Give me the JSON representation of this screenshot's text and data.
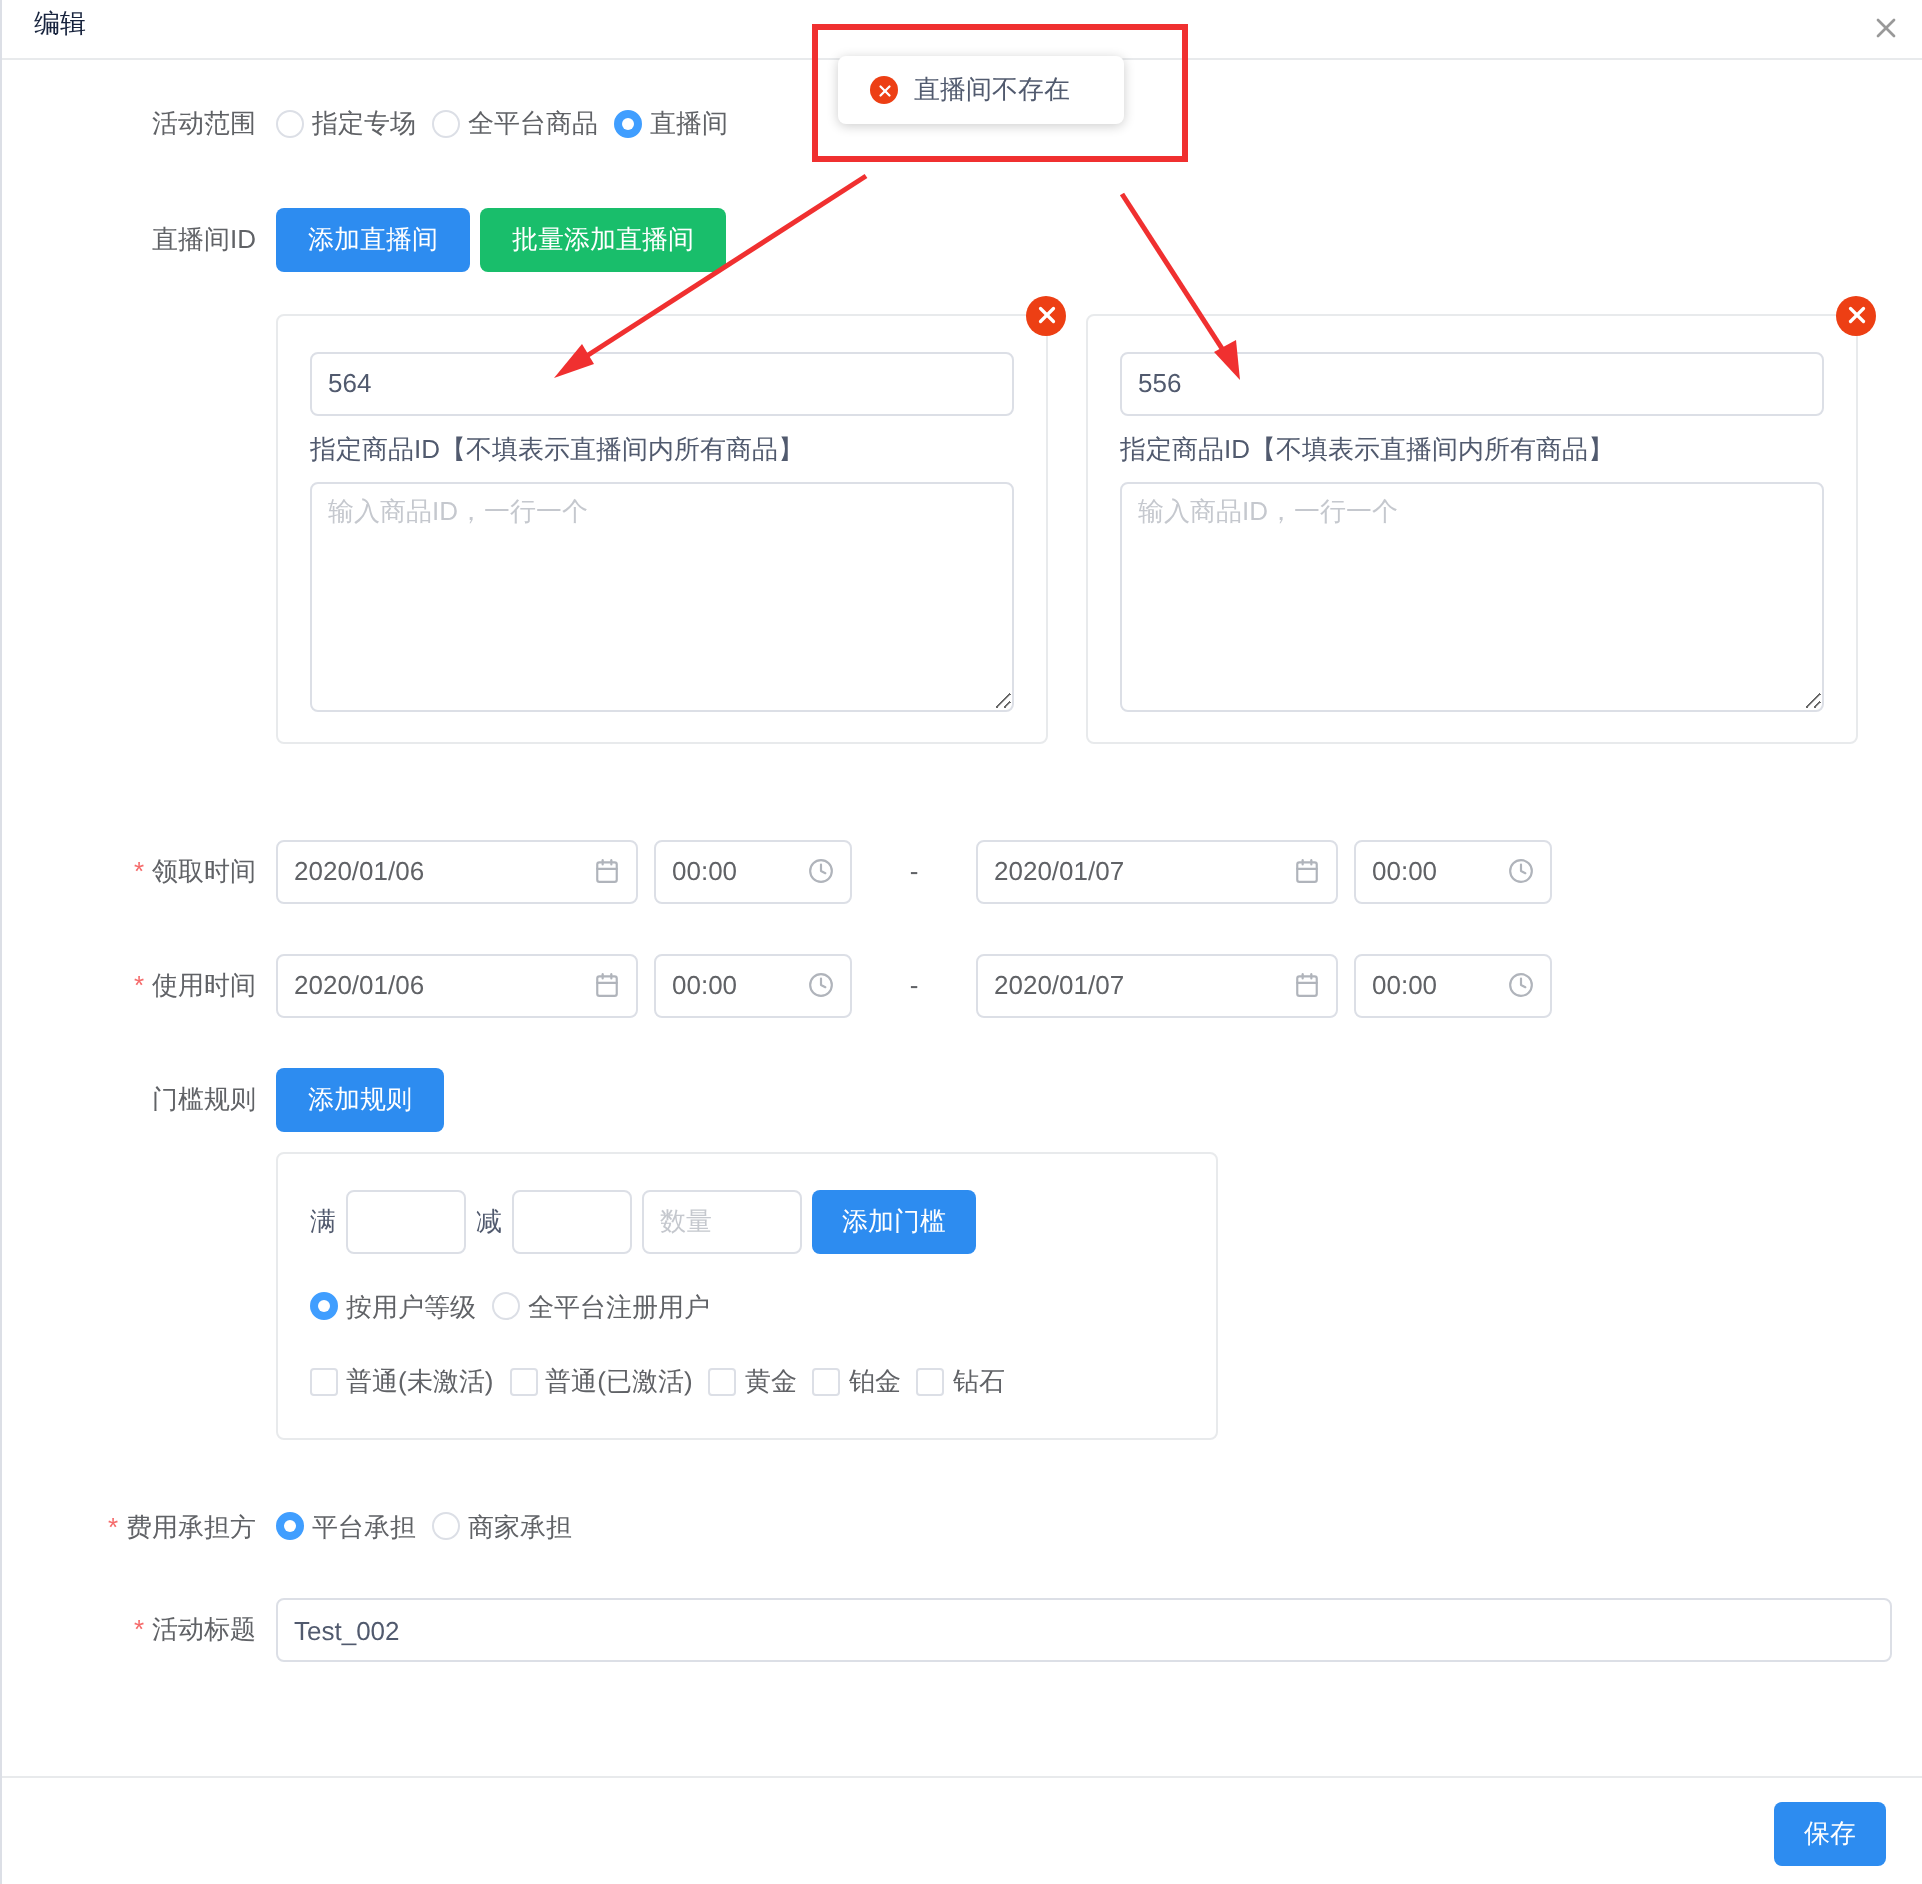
{
  "dialog": {
    "title": "编辑"
  },
  "toast": {
    "message": "直播间不存在"
  },
  "scope": {
    "label": "活动范围",
    "options": [
      {
        "label": "指定专场",
        "selected": false
      },
      {
        "label": "全平台商品",
        "selected": false
      },
      {
        "label": "直播间",
        "selected": true
      }
    ]
  },
  "rooms": {
    "label": "直播间ID",
    "buttons": [
      {
        "label": "添加直播间",
        "kind": "primary"
      },
      {
        "label": "批量添加直播间",
        "kind": "success"
      }
    ],
    "cards": [
      {
        "room_id": "564",
        "goods_label": "指定商品ID【不填表示直播间内所有商品】",
        "goods_placeholder": "输入商品ID，一行一个"
      },
      {
        "room_id": "556",
        "goods_label": "指定商品ID【不填表示直播间内所有商品】",
        "goods_placeholder": "输入商品ID，一行一个"
      }
    ]
  },
  "times": [
    {
      "required_mark": "*",
      "label": "领取时间",
      "start_date": "2020/01/06",
      "start_time": "00:00",
      "separator": "-",
      "end_date": "2020/01/07",
      "end_time": "00:00"
    },
    {
      "required_mark": "*",
      "label": "使用时间",
      "start_date": "2020/01/06",
      "start_time": "00:00",
      "separator": "-",
      "end_date": "2020/01/07",
      "end_time": "00:00"
    }
  ],
  "threshold": {
    "label": "门槛规则",
    "add_button": "添加规则",
    "full_label": "满",
    "minus_label": "减",
    "quantity_placeholder": "数量",
    "add_threshold_button": "添加门槛",
    "user_scope": [
      {
        "label": "按用户等级",
        "selected": true
      },
      {
        "label": "全平台注册用户",
        "selected": false
      }
    ],
    "levels": [
      {
        "label": "普通(未激活)",
        "checked": false
      },
      {
        "label": "普通(已激活)",
        "checked": false
      },
      {
        "label": "黄金",
        "checked": false
      },
      {
        "label": "铂金",
        "checked": false
      },
      {
        "label": "钻石",
        "checked": false
      }
    ]
  },
  "cost_bearer": {
    "required_mark": "*",
    "label": "费用承担方",
    "options": [
      {
        "label": "平台承担",
        "selected": true
      },
      {
        "label": "商家承担",
        "selected": false
      }
    ]
  },
  "title_field": {
    "required_mark": "*",
    "label": "活动标题",
    "value": "Test_002"
  },
  "footer": {
    "save_button": "保存"
  }
}
